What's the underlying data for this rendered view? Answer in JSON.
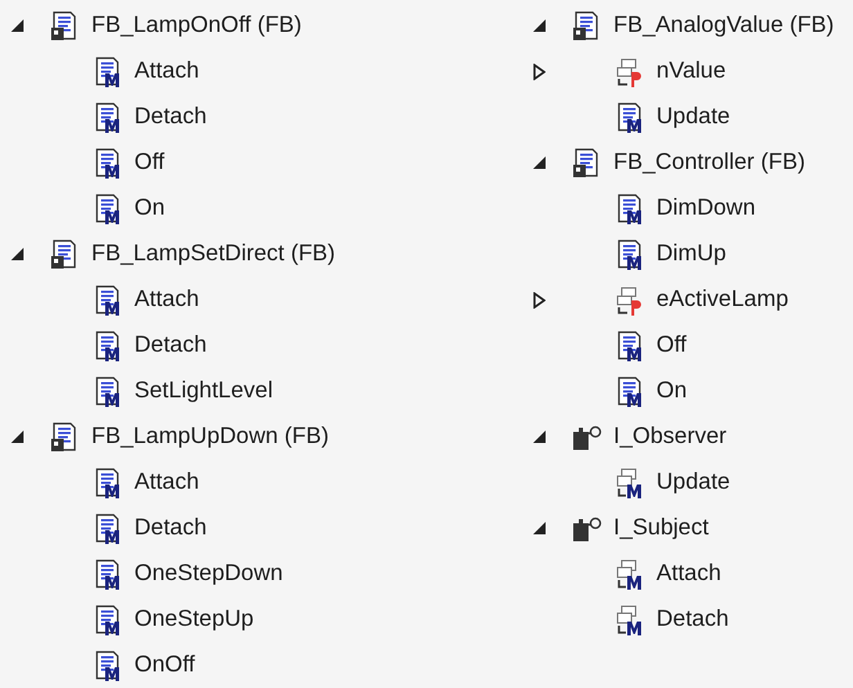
{
  "columns": [
    {
      "nodes": [
        {
          "label": "FB_LampOnOff (FB)",
          "kind": "fb",
          "expanded": true,
          "children": [
            {
              "label": "Attach",
              "kind": "method"
            },
            {
              "label": "Detach",
              "kind": "method"
            },
            {
              "label": "Off",
              "kind": "method"
            },
            {
              "label": "On",
              "kind": "method"
            }
          ]
        },
        {
          "label": "FB_LampSetDirect (FB)",
          "kind": "fb",
          "expanded": true,
          "children": [
            {
              "label": "Attach",
              "kind": "method"
            },
            {
              "label": "Detach",
              "kind": "method"
            },
            {
              "label": "SetLightLevel",
              "kind": "method"
            }
          ]
        },
        {
          "label": "FB_LampUpDown (FB)",
          "kind": "fb",
          "expanded": true,
          "children": [
            {
              "label": "Attach",
              "kind": "method"
            },
            {
              "label": "Detach",
              "kind": "method"
            },
            {
              "label": "OneStepDown",
              "kind": "method"
            },
            {
              "label": "OneStepUp",
              "kind": "method"
            },
            {
              "label": "OnOff",
              "kind": "method"
            }
          ]
        }
      ]
    },
    {
      "nodes": [
        {
          "label": "FB_AnalogValue (FB)",
          "kind": "fb",
          "expanded": true,
          "children": [
            {
              "label": "nValue",
              "kind": "property",
              "expanded": false
            },
            {
              "label": "Update",
              "kind": "method"
            }
          ]
        },
        {
          "label": "FB_Controller (FB)",
          "kind": "fb",
          "expanded": true,
          "children": [
            {
              "label": "DimDown",
              "kind": "method"
            },
            {
              "label": "DimUp",
              "kind": "method"
            },
            {
              "label": "eActiveLamp",
              "kind": "property",
              "expanded": false
            },
            {
              "label": "Off",
              "kind": "method"
            },
            {
              "label": "On",
              "kind": "method"
            }
          ]
        },
        {
          "label": "I_Observer",
          "kind": "interface",
          "expanded": true,
          "children": [
            {
              "label": "Update",
              "kind": "interface_method"
            }
          ]
        },
        {
          "label": "I_Subject",
          "kind": "interface",
          "expanded": true,
          "children": [
            {
              "label": "Attach",
              "kind": "interface_method"
            },
            {
              "label": "Detach",
              "kind": "interface_method"
            }
          ]
        }
      ]
    }
  ]
}
